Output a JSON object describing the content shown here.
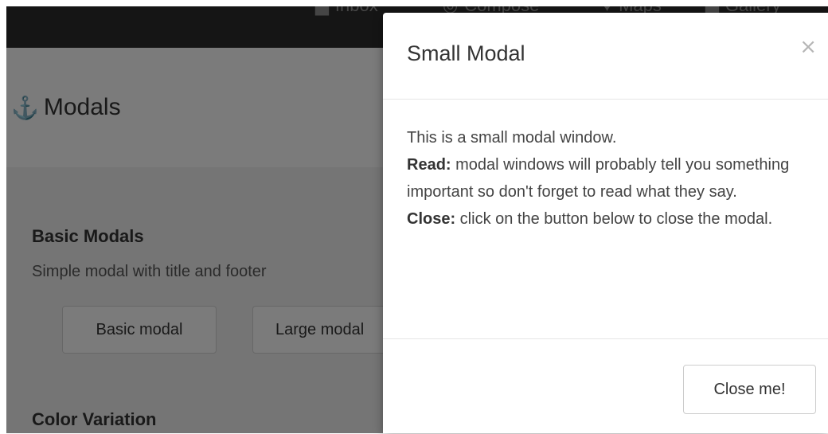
{
  "nav": {
    "items": [
      {
        "icon": "inbox-icon",
        "glyph": "▆",
        "label": "Inbox"
      },
      {
        "icon": "compose-icon",
        "glyph": "◎",
        "label": "Compose"
      },
      {
        "icon": "map-marker-icon",
        "glyph": "♥",
        "label": "Maps"
      },
      {
        "icon": "gallery-icon",
        "glyph": "▇",
        "label": "Gallery"
      }
    ]
  },
  "page": {
    "title_icon": "⚓",
    "title": "Modals",
    "sections": {
      "basic_title": "Basic Modals",
      "basic_desc": "Simple modal with title and footer",
      "basic_modal_button": "Basic modal",
      "large_modal_button": "Large modal",
      "color_title": "Color Variation"
    }
  },
  "modal": {
    "title": "Small Modal",
    "close_glyph": "×",
    "body_line1": "This is a small modal window.",
    "read_label": "Read:",
    "read_text": " modal windows will probably tell you something important so don't forget to read what they say.",
    "close_label": "Close:",
    "close_text": " click on the button below to close the modal.",
    "footer_button": "Close me!"
  }
}
